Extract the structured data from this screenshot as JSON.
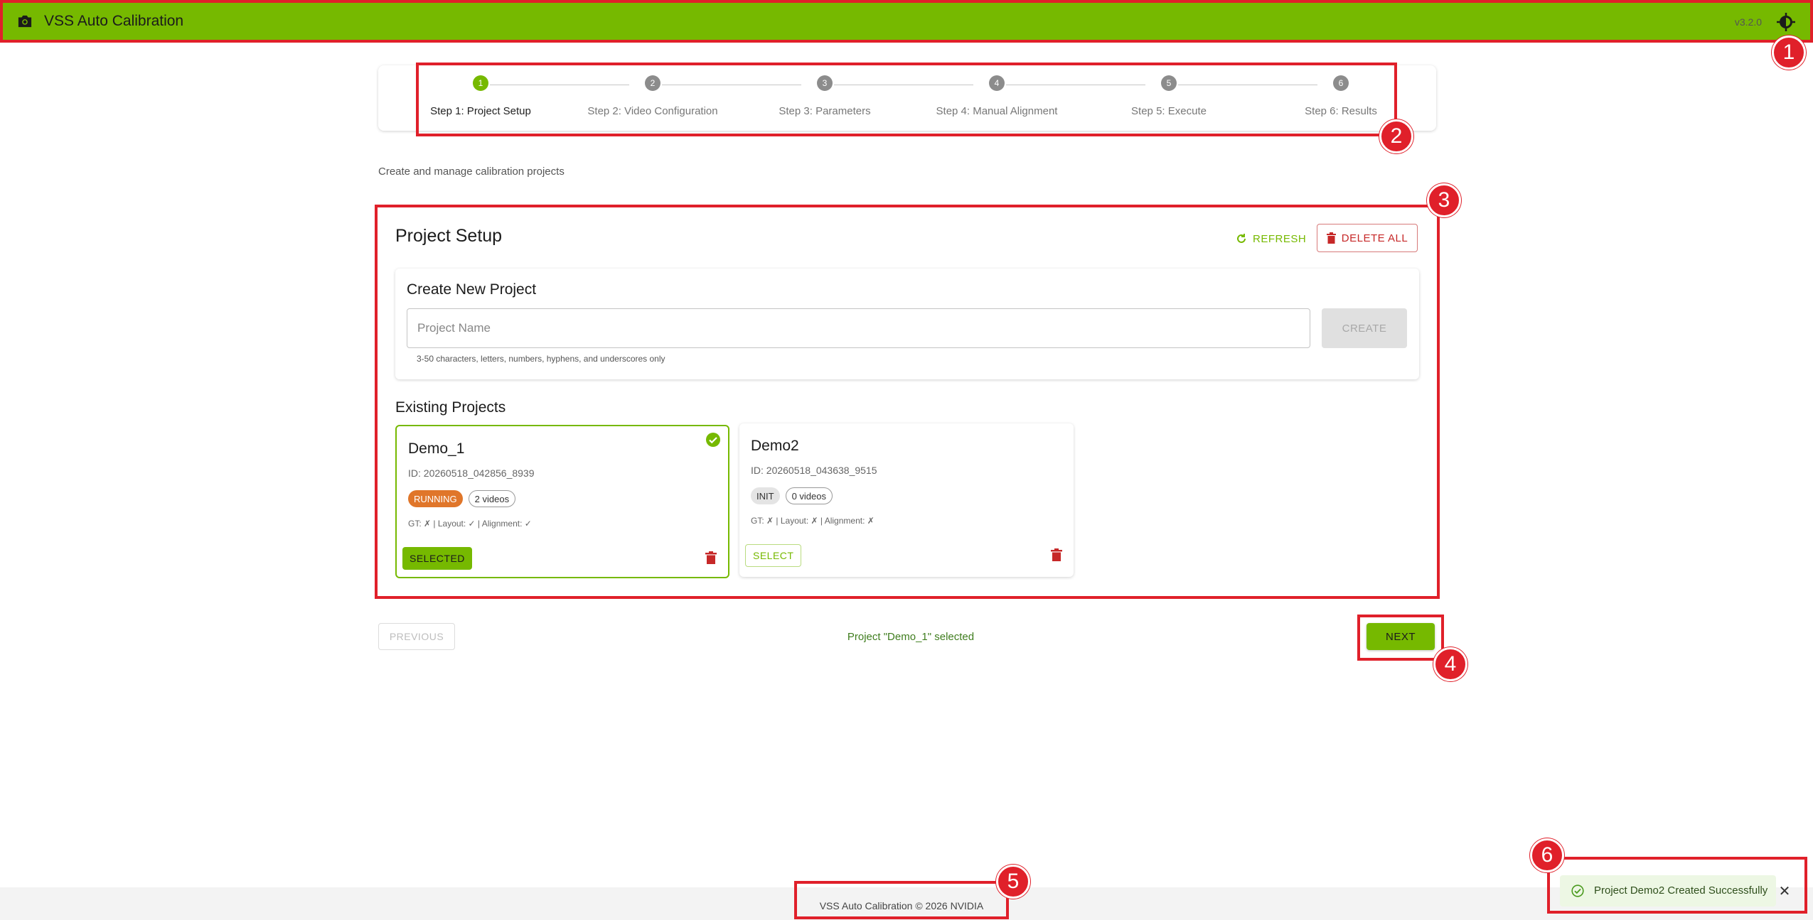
{
  "app": {
    "title": "VSS Auto Calibration",
    "version": "v3.2.0",
    "camera_icon": "camera-icon",
    "theme_icon": "theme-toggle-icon",
    "accent_color": "#76b900"
  },
  "stepper": {
    "steps": [
      {
        "number": "1",
        "label": "Step 1: Project Setup",
        "active": true
      },
      {
        "number": "2",
        "label": "Step 2: Video Configuration",
        "active": false
      },
      {
        "number": "3",
        "label": "Step 3: Parameters",
        "active": false
      },
      {
        "number": "4",
        "label": "Step 4: Manual Alignment",
        "active": false
      },
      {
        "number": "5",
        "label": "Step 5: Execute",
        "active": false
      },
      {
        "number": "6",
        "label": "Step 6: Results",
        "active": false
      }
    ]
  },
  "page": {
    "subtitle": "Create and manage calibration projects"
  },
  "setup": {
    "title": "Project Setup",
    "refresh_label": "REFRESH",
    "delete_all_label": "DELETE ALL",
    "create": {
      "title": "Create New Project",
      "placeholder": "Project Name",
      "value": "",
      "button_label": "CREATE",
      "helper": "3-50 characters, letters, numbers, hyphens, and underscores only"
    },
    "existing_title": "Existing Projects",
    "projects": [
      {
        "name": "Demo_1",
        "id": "ID: 20260518_042856_8939",
        "status": "RUNNING",
        "videos": "2 videos",
        "flags": "GT: ✗ | Layout: ✓ | Alignment: ✓",
        "button_label": "SELECTED",
        "selected": true
      },
      {
        "name": "Demo2",
        "id": "ID: 20260518_043638_9515",
        "status": "INIT",
        "videos": "0 videos",
        "flags": "GT: ✗ | Layout: ✗ | Alignment: ✗",
        "button_label": "SELECT",
        "selected": false
      }
    ]
  },
  "nav": {
    "previous_label": "PREVIOUS",
    "status_message": "Project \"Demo_1\" selected",
    "next_label": "NEXT"
  },
  "footer": {
    "text": "VSS Auto Calibration © 2026 NVIDIA"
  },
  "snackbar": {
    "message": "Project Demo2 Created Successfully",
    "close_label": "✕"
  },
  "annotations": [
    "1",
    "2",
    "3",
    "4",
    "5",
    "6"
  ]
}
